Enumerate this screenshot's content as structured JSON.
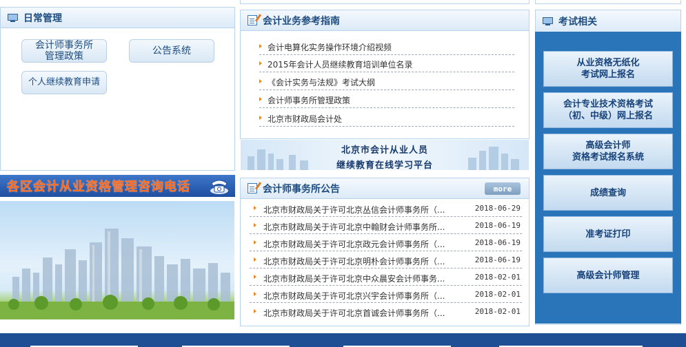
{
  "daily": {
    "title": "日常管理",
    "buttons": [
      {
        "label": "会计师事务所\n管理政策"
      },
      {
        "label": "公告系统"
      },
      {
        "label": "个人继续教育申请"
      }
    ]
  },
  "consult_banner": {
    "text": "各区会计从业资格管理咨询电话"
  },
  "guide": {
    "title": "会计业务参考指南",
    "items": [
      {
        "label": "会计电算化实务操作环境介绍视频"
      },
      {
        "label": "2015年会计人员继续教育培训单位名录"
      },
      {
        "label": "《会计实务与法规》考试大纲"
      },
      {
        "label": "会计师事务所管理政策"
      },
      {
        "label": "北京市财政局会计处"
      }
    ]
  },
  "learn_banner": {
    "line1": "北京市会计从业人员",
    "line2": "继续教育在线学习平台"
  },
  "notices": {
    "title": "会计师事务所公告",
    "more": "more",
    "items": [
      {
        "label": "北京市财政局关于许可北京丛信会计师事务所（...",
        "date": "2018-06-29"
      },
      {
        "label": "北京市财政局关于许可北京中翰财会计师事务所...",
        "date": "2018-06-19"
      },
      {
        "label": "北京市财政局关于许可北京政元会计师事务所（...",
        "date": "2018-06-19"
      },
      {
        "label": "北京市财政局关于许可北京明朴会计师事务所（...",
        "date": "2018-06-19"
      },
      {
        "label": "北京市财政局关于许可北京中众晨安会计师事务...",
        "date": "2018-02-01"
      },
      {
        "label": "北京市财政局关于许可北京兴宇会计师事务所（...",
        "date": "2018-02-01"
      },
      {
        "label": "北京市财政局关于许可北京首诚会计师事务所（...",
        "date": "2018-02-01"
      }
    ]
  },
  "exam": {
    "title": "考试相关",
    "buttons": [
      {
        "label": "从业资格无纸化\n考试网上报名"
      },
      {
        "label": "会计专业技术资格考试\n（初、中级）网上报名"
      },
      {
        "label": "高级会计师\n资格考试报名系统"
      },
      {
        "label": "成绩查询"
      },
      {
        "label": "准考证打印"
      },
      {
        "label": "高级会计师管理"
      }
    ]
  },
  "colors": {
    "accent": "#1f4d80",
    "banner_orange": "#ff6a1a",
    "exam_blue": "#2a74ba",
    "footer_blue": "#1e4f95"
  }
}
